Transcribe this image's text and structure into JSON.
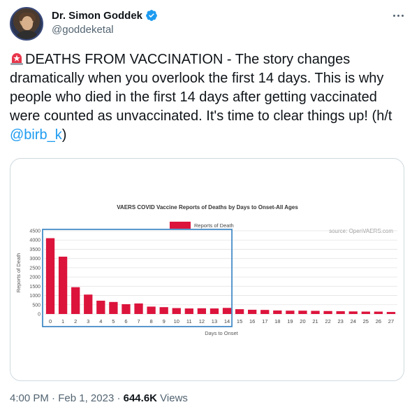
{
  "author": {
    "name": "Dr. Simon Goddek",
    "handle": "@goddeketal",
    "verified": true,
    "avatar_icon": "profile-photo"
  },
  "tweet": {
    "text_main": "DEATHS FROM VACCINATION - The story changes dramatically when you overlook the first 14 days. This is why people who died in the first 14 days after getting vaccinated were counted as unvaccinated. It's time to clear things up! (h/t ",
    "mention": "@birb_k",
    "text_end": ")",
    "leading_emoji": "siren-icon"
  },
  "footer": {
    "time": "4:00 PM",
    "separator1": "·",
    "date": "Feb 1, 2023",
    "separator2": "·",
    "views_count": "644.6K",
    "views_label": "Views"
  },
  "colors": {
    "accent": "#1d9bf0",
    "bar": "#dc143c",
    "highlight_box": "#2f7fc1"
  },
  "chart_data": {
    "type": "bar",
    "title": "VAERS COVID Vaccine Reports of Deaths by Days to Onset-All Ages",
    "legend": "Reports of Death",
    "source": "source: OpenVAERS.com",
    "xlabel": "Days to Onset",
    "ylabel": "Reports of Death",
    "ylim": [
      0,
      4500
    ],
    "yticks": [
      0,
      500,
      1000,
      1500,
      2000,
      2500,
      3000,
      3500,
      4000,
      4500
    ],
    "categories": [
      "0",
      "1",
      "2",
      "3",
      "4",
      "5",
      "6",
      "7",
      "8",
      "9",
      "10",
      "11",
      "12",
      "13",
      "14",
      "15",
      "16",
      "17",
      "18",
      "19",
      "20",
      "21",
      "22",
      "23",
      "24",
      "25",
      "26",
      "27"
    ],
    "values": [
      4100,
      3100,
      1450,
      1050,
      720,
      650,
      530,
      570,
      400,
      370,
      320,
      300,
      310,
      300,
      330,
      260,
      230,
      220,
      190,
      180,
      180,
      170,
      160,
      150,
      140,
      130,
      130,
      110
    ],
    "highlight_range": [
      0,
      14
    ],
    "grid": true,
    "legend_position": "top-center"
  }
}
